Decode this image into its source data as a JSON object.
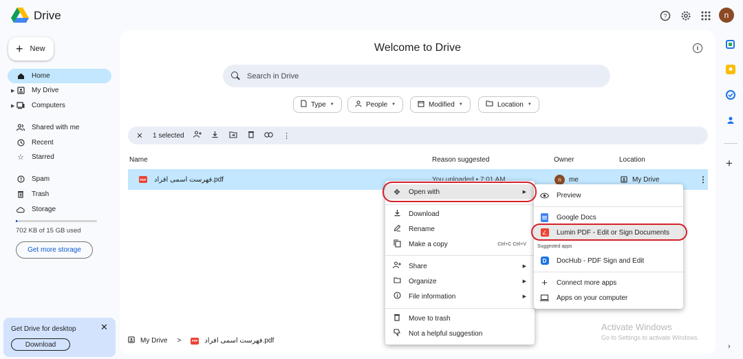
{
  "app": {
    "name": "Drive"
  },
  "sidebar": {
    "new_label": "New",
    "items": [
      {
        "label": "Home"
      },
      {
        "label": "My Drive"
      },
      {
        "label": "Computers"
      },
      {
        "label": "Shared with me"
      },
      {
        "label": "Recent"
      },
      {
        "label": "Starred"
      },
      {
        "label": "Spam"
      },
      {
        "label": "Trash"
      },
      {
        "label": "Storage"
      }
    ],
    "storage_text": "702 KB of 15 GB used",
    "storage_fraction": 4.68e-05,
    "get_storage": "Get more storage",
    "desktop_title": "Get Drive for desktop",
    "desktop_close": "✕",
    "desktop_download": "Download"
  },
  "main": {
    "title": "Welcome to Drive",
    "search_placeholder": "Search in Drive",
    "filters": [
      {
        "label": "Type"
      },
      {
        "label": "People"
      },
      {
        "label": "Modified"
      },
      {
        "label": "Location"
      }
    ],
    "selection": "1 selected",
    "columns": {
      "name": "Name",
      "reason": "Reason suggested",
      "owner": "Owner",
      "location": "Location"
    },
    "file": {
      "name": "فهرست اسمی افراد.pdf",
      "reason": "You uploaded • 7:01 AM",
      "owner_initial": "n",
      "owner": "me",
      "location": "My Drive"
    },
    "breadcrumb": {
      "root": "My Drive",
      "sep": ">",
      "file": "فهرست اسمی افراد.pdf"
    }
  },
  "context_menu": {
    "items": [
      {
        "label": "Open with"
      },
      {
        "label": "Download"
      },
      {
        "label": "Rename"
      },
      {
        "label": "Make a copy",
        "shortcut": "Ctrl+C Ctrl+V"
      },
      {
        "label": "Share"
      },
      {
        "label": "Organize"
      },
      {
        "label": "File information"
      },
      {
        "label": "Move to trash"
      },
      {
        "label": "Not a helpful suggestion"
      }
    ]
  },
  "submenu": {
    "items": [
      {
        "label": "Preview"
      },
      {
        "label": "Google Docs"
      },
      {
        "label": "Lumin PDF - Edit or Sign Documents"
      },
      {
        "label": "DocHub - PDF Sign and Edit"
      },
      {
        "label": "Connect more apps"
      },
      {
        "label": "Apps on your computer"
      }
    ],
    "section_label": "Suggested apps"
  },
  "watermark": {
    "title": "Activate Windows",
    "subtitle": "Go to Settings to activate Windows."
  },
  "user": {
    "initial": "n"
  },
  "colors": {
    "accent": "#0b57d0",
    "selection": "#c2e7ff",
    "highlight_ring": "#d6202a",
    "avatar": "#8b4a24"
  }
}
